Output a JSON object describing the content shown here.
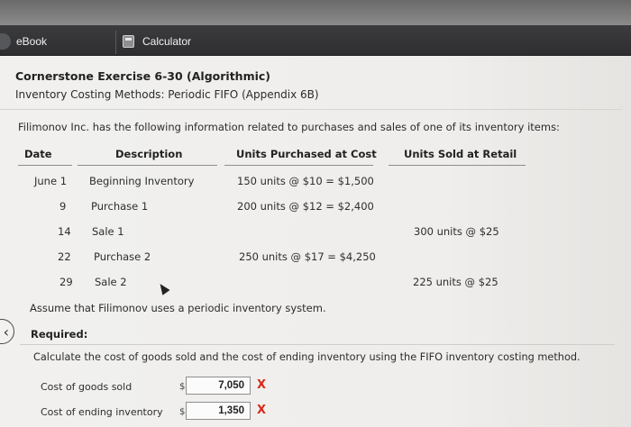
{
  "tabs": {
    "ebook": "eBook",
    "calculator": "Calculator"
  },
  "exercise": {
    "title": "Cornerstone Exercise 6-30 (Algorithmic)",
    "subtitle": "Inventory Costing Methods: Periodic FIFO (Appendix 6B)",
    "intro": "Filimonov Inc. has the following information related to purchases and sales of one of its inventory items:"
  },
  "table": {
    "headers": {
      "date": "Date",
      "description": "Description",
      "units_purchased": "Units Purchased at Cost",
      "units_sold": "Units Sold at Retail"
    },
    "rows": [
      {
        "date": "June 1",
        "description": "Beginning Inventory",
        "purchased": "150 units @ $10 = $1,500",
        "sold": ""
      },
      {
        "date": "9",
        "description": "Purchase 1",
        "purchased": "200 units @ $12 = $2,400",
        "sold": ""
      },
      {
        "date": "14",
        "description": "Sale 1",
        "purchased": "",
        "sold": "300 units @ $25"
      },
      {
        "date": "22",
        "description": "Purchase 2",
        "purchased": "250 units @ $17 = $4,250",
        "sold": ""
      },
      {
        "date": "29",
        "description": "Sale 2",
        "purchased": "",
        "sold": "225 units @ $25"
      }
    ]
  },
  "assumption": "Assume that Filimonov uses a periodic inventory system.",
  "required": {
    "heading": "Required:",
    "instruction": "Calculate the cost of goods sold and the cost of ending inventory using the FIFO inventory costing method."
  },
  "answers": [
    {
      "label": "Cost of goods sold",
      "currency": "$",
      "value": "7,050",
      "mark": "X"
    },
    {
      "label": "Cost of ending inventory",
      "currency": "$",
      "value": "1,350",
      "mark": "X"
    }
  ],
  "colors": {
    "wrong_mark": "#d8291a",
    "tab_bar": "#2e2e30"
  },
  "icons": {
    "calculator": "calculator-icon",
    "back": "chevron-left-icon",
    "cursor": "mouse-pointer-icon"
  }
}
